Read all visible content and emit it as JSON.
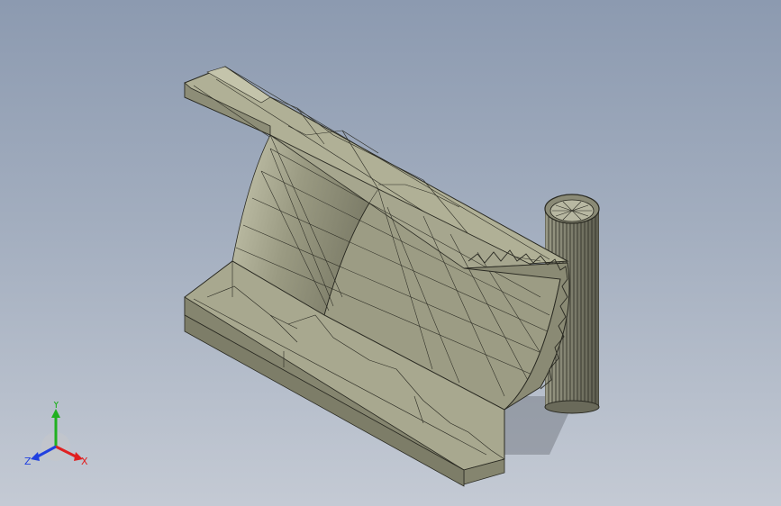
{
  "viewport": {
    "background_top": "#8c9ab0",
    "background_bottom": "#c4cad4"
  },
  "model": {
    "description_icon": "half-pipe-with-tube-part",
    "face_color": "#b4b49a",
    "edge_color": "#2a2a22"
  },
  "triad": {
    "x_label": "X",
    "y_label": "Y",
    "z_label": "Z",
    "x_color": "#e02020",
    "y_color": "#20b020",
    "z_color": "#2040e0"
  }
}
